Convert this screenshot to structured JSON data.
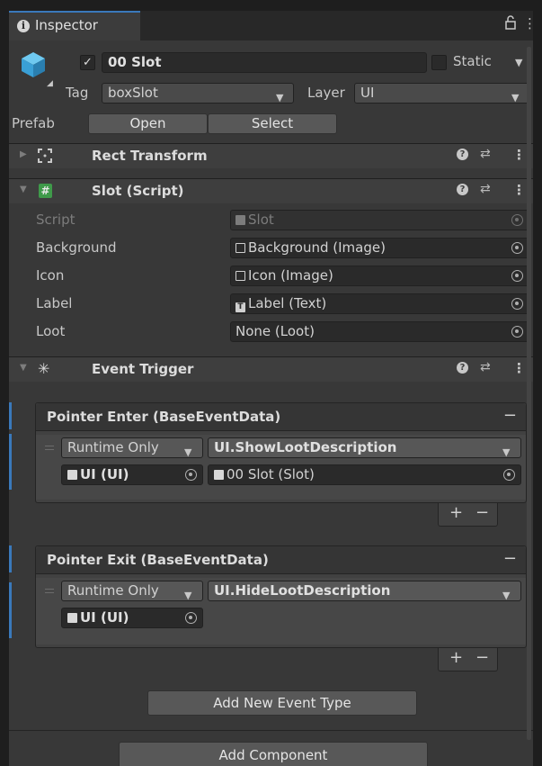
{
  "tab": {
    "label": "Inspector",
    "icon": "info-icon"
  },
  "object": {
    "name": "00 Slot",
    "active_checked": true,
    "static_label": "Static",
    "tag_label": "Tag",
    "tag_value": "boxSlot",
    "layer_label": "Layer",
    "layer_value": "UI",
    "prefab_label": "Prefab",
    "prefab_open": "Open",
    "prefab_select": "Select"
  },
  "components": {
    "rect_transform": {
      "title": "Rect Transform"
    },
    "slot_script": {
      "title": "Slot (Script)",
      "fields": [
        {
          "label": "Script",
          "value": "Slot",
          "icon": "script-icon",
          "disabled": true
        },
        {
          "label": "Background",
          "value": "Background (Image)",
          "icon": "image-icon"
        },
        {
          "label": "Icon",
          "value": "Icon (Image)",
          "icon": "image-icon"
        },
        {
          "label": "Label",
          "value": "Label (Text)",
          "icon": "text-icon"
        },
        {
          "label": "Loot",
          "value": "None (Loot)",
          "icon": ""
        }
      ]
    },
    "event_trigger": {
      "title": "Event Trigger",
      "events": [
        {
          "title": "Pointer Enter (BaseEventData)",
          "runtime": "Runtime Only",
          "function": "UI.ShowLootDescription",
          "target": "UI (UI)",
          "argument": "00 Slot (Slot)"
        },
        {
          "title": "Pointer Exit (BaseEventData)",
          "runtime": "Runtime Only",
          "function": "UI.HideLootDescription",
          "target": "UI (UI)",
          "argument": ""
        }
      ],
      "add_event_label": "Add New Event Type"
    }
  },
  "add_component_label": "Add Component",
  "symbols": {
    "plus": "+",
    "minus": "−",
    "check": "✓",
    "menu": "⋮",
    "help": "?"
  },
  "colors": {
    "accent": "#3a79bb",
    "panel_bg": "#383838",
    "field_bg": "#2a2a2a"
  }
}
